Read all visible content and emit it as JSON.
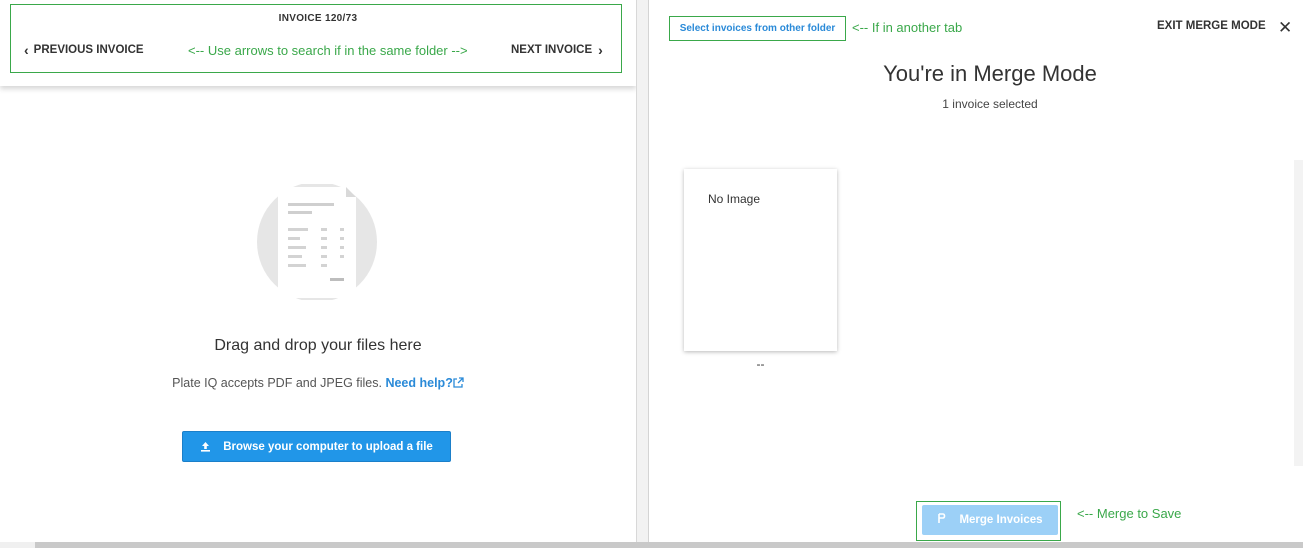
{
  "left": {
    "invoice_title": "INVOICE 120/73",
    "prev_label": "PREVIOUS INVOICE",
    "next_label": "NEXT INVOICE",
    "nav_annotation": "<-- Use arrows to search if in the same folder -->",
    "drop_title": "Drag and drop your files here",
    "accept_text": "Plate IQ accepts PDF and JPEG files.",
    "help_link": "Need help?",
    "upload_label": "Browse your computer to upload a file"
  },
  "right": {
    "select_other_label": "Select invoices from other folder",
    "tab_annotation": "<-- If in another tab",
    "exit_label": "EXIT MERGE MODE",
    "title": "You're in Merge Mode",
    "selected_count": "1 invoice selected",
    "card": {
      "no_image": "No Image",
      "caption": "--"
    },
    "merge_label": "Merge Invoices",
    "merge_annotation": "<-- Merge to Save"
  },
  "icons": {
    "prev": "chevron-left-icon",
    "next": "chevron-right-icon",
    "upload": "upload-icon",
    "external": "external-link-icon",
    "close": "close-icon",
    "merge": "merge-icon",
    "illustration": "document-illustration"
  },
  "colors": {
    "annotation_green": "#3aa84a",
    "link_blue": "#2a8ad8",
    "primary_blue": "#2196e8",
    "disabled_blue": "#9cd0f7"
  }
}
